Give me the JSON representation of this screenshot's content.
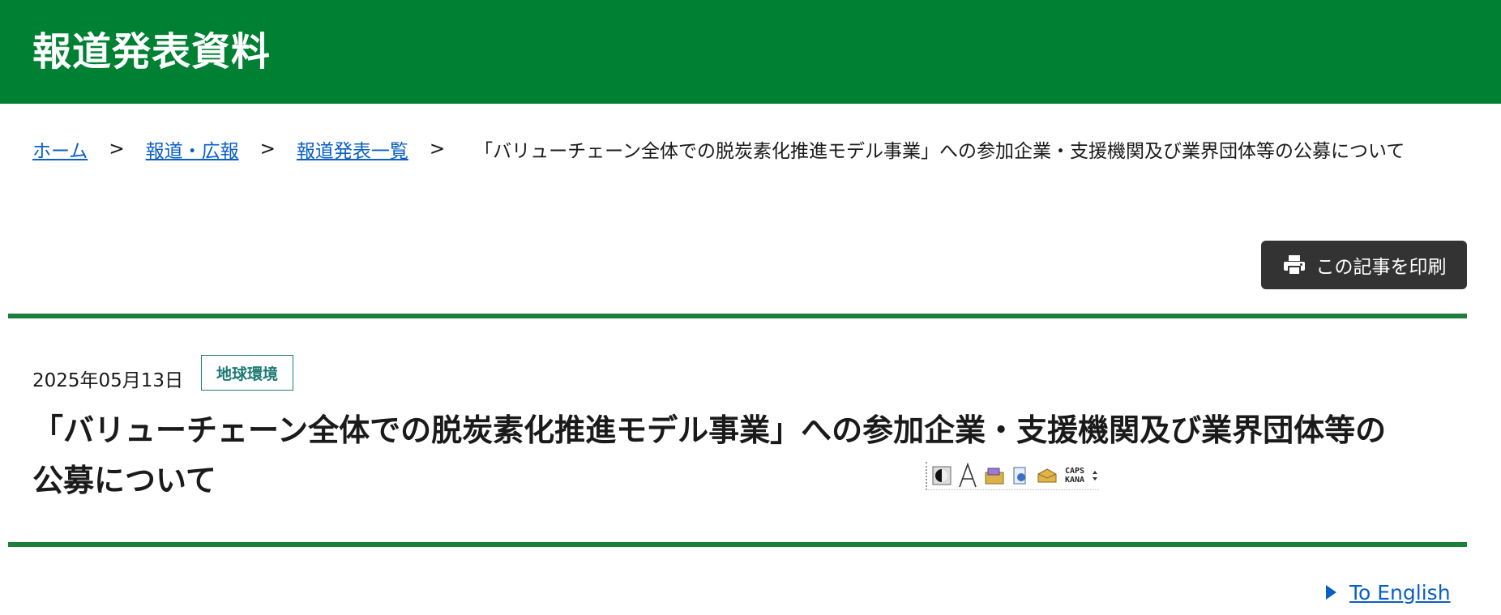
{
  "header": {
    "title": "報道発表資料",
    "background_color": "#008033"
  },
  "breadcrumb": {
    "items": [
      {
        "label": "ホーム"
      },
      {
        "label": "報道・広報"
      },
      {
        "label": "報道発表一覧"
      }
    ],
    "separator": ">",
    "current": "「バリューチェーン全体での脱炭素化推進モデル事業」への参加企業・支援機関及び業界団体等の公募について"
  },
  "print_button": {
    "label": "この記事を印刷",
    "icon": "printer-icon"
  },
  "article": {
    "date": "2025年05月13日",
    "tag": "地球環境",
    "title_line1": "「バリューチェーン全体での脱炭素化推進モデル事業」への参加企業・支援機関及び業界団体等の",
    "title_line2": "公募について"
  },
  "ime_toolbar": {
    "caps": "CAPS",
    "kana": "KANA",
    "icons": [
      "ime-mode-icon",
      "font-a-icon",
      "dictionary-tool-icon",
      "properties-icon",
      "toolbox-icon",
      "dropdown-icon"
    ]
  },
  "english_link": {
    "label": "To English"
  },
  "colors": {
    "accent_green": "#008033",
    "link_blue": "#0b5fc5",
    "tag_teal": "#1e7a74",
    "button_dark": "#333333"
  }
}
